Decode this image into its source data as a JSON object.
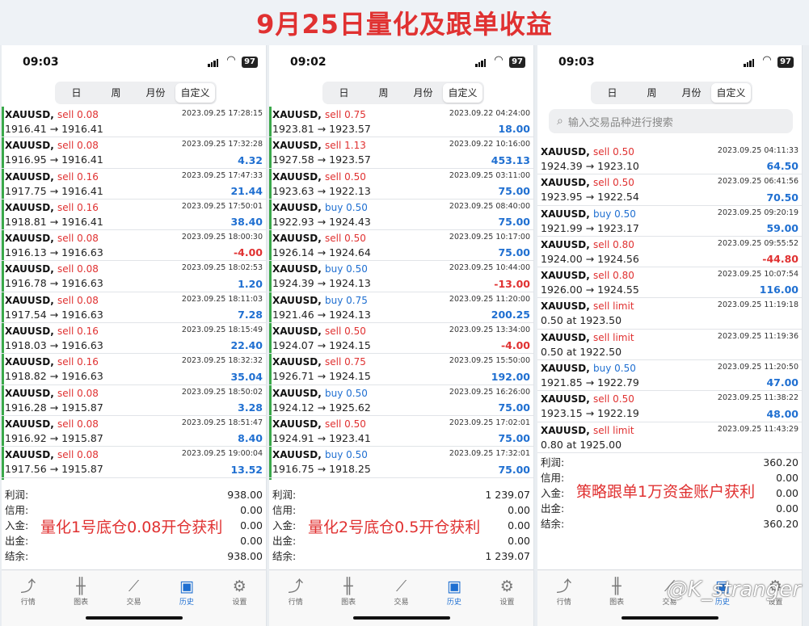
{
  "banner": {
    "title": "9月25日量化及跟单收益"
  },
  "segments": [
    "日",
    "周",
    "月份",
    "自定义"
  ],
  "tabs": [
    {
      "icon": "chart-line-icon",
      "glyph": "⤴",
      "label": "行情"
    },
    {
      "icon": "candlestick-icon",
      "glyph": "╫",
      "label": "图表"
    },
    {
      "icon": "trade-icon",
      "glyph": "⟋",
      "label": "交易"
    },
    {
      "icon": "history-icon",
      "glyph": "▣",
      "label": "历史"
    },
    {
      "icon": "gear-icon",
      "glyph": "⚙",
      "label": "设置"
    }
  ],
  "totals_labels": [
    "利润:",
    "信用:",
    "入金:",
    "出金:",
    "结余:"
  ],
  "phones": [
    {
      "time": "09:03",
      "battery": "97",
      "annotation": "量化1号底仓0.08开仓获利",
      "rows": [
        {
          "sym": "XAUUSD",
          "side": "sell",
          "lots": "0.08",
          "dt": "2023.09.25 17:28:15",
          "prices": "1916.41 → 1916.41",
          "pl": ""
        },
        {
          "sym": "XAUUSD",
          "side": "sell",
          "lots": "0.08",
          "dt": "2023.09.25 17:32:28",
          "prices": "1916.95 → 1916.41",
          "pl": "4.32"
        },
        {
          "sym": "XAUUSD",
          "side": "sell",
          "lots": "0.16",
          "dt": "2023.09.25 17:47:33",
          "prices": "1917.75 → 1916.41",
          "pl": "21.44"
        },
        {
          "sym": "XAUUSD",
          "side": "sell",
          "lots": "0.16",
          "dt": "2023.09.25 17:50:01",
          "prices": "1918.81 → 1916.41",
          "pl": "38.40"
        },
        {
          "sym": "XAUUSD",
          "side": "sell",
          "lots": "0.08",
          "dt": "2023.09.25 18:00:30",
          "prices": "1916.13 → 1916.63",
          "pl": "-4.00"
        },
        {
          "sym": "XAUUSD",
          "side": "sell",
          "lots": "0.08",
          "dt": "2023.09.25 18:02:53",
          "prices": "1916.78 → 1916.63",
          "pl": "1.20"
        },
        {
          "sym": "XAUUSD",
          "side": "sell",
          "lots": "0.08",
          "dt": "2023.09.25 18:11:03",
          "prices": "1917.54 → 1916.63",
          "pl": "7.28"
        },
        {
          "sym": "XAUUSD",
          "side": "sell",
          "lots": "0.16",
          "dt": "2023.09.25 18:15:49",
          "prices": "1918.03 → 1916.63",
          "pl": "22.40"
        },
        {
          "sym": "XAUUSD",
          "side": "sell",
          "lots": "0.16",
          "dt": "2023.09.25 18:32:32",
          "prices": "1918.82 → 1916.63",
          "pl": "35.04"
        },
        {
          "sym": "XAUUSD",
          "side": "sell",
          "lots": "0.08",
          "dt": "2023.09.25 18:50:02",
          "prices": "1916.28 → 1915.87",
          "pl": "3.28"
        },
        {
          "sym": "XAUUSD",
          "side": "sell",
          "lots": "0.08",
          "dt": "2023.09.25 18:51:47",
          "prices": "1916.92 → 1915.87",
          "pl": "8.40"
        },
        {
          "sym": "XAUUSD",
          "side": "sell",
          "lots": "0.08",
          "dt": "2023.09.25 19:00:04",
          "prices": "1917.56 → 1915.87",
          "pl": "13.52"
        }
      ],
      "totals": [
        "938.00",
        "0.00",
        "0.00",
        "0.00",
        "938.00"
      ]
    },
    {
      "time": "09:02",
      "battery": "97",
      "annotation": "量化2号底仓0.5开仓获利",
      "rows": [
        {
          "sym": "XAUUSD",
          "side": "sell",
          "lots": "0.75",
          "dt": "2023.09.22 04:24:00",
          "prices": "1923.81 → 1923.57",
          "pl": "18.00"
        },
        {
          "sym": "XAUUSD",
          "side": "sell",
          "lots": "1.13",
          "dt": "2023.09.22 10:16:00",
          "prices": "1927.58 → 1923.57",
          "pl": "453.13"
        },
        {
          "sym": "XAUUSD",
          "side": "sell",
          "lots": "0.50",
          "dt": "2023.09.25 03:11:00",
          "prices": "1923.63 → 1922.13",
          "pl": "75.00"
        },
        {
          "sym": "XAUUSD",
          "side": "buy",
          "lots": "0.50",
          "dt": "2023.09.25 08:40:00",
          "prices": "1922.93 → 1924.43",
          "pl": "75.00"
        },
        {
          "sym": "XAUUSD",
          "side": "sell",
          "lots": "0.50",
          "dt": "2023.09.25 10:17:00",
          "prices": "1926.14 → 1924.64",
          "pl": "75.00"
        },
        {
          "sym": "XAUUSD",
          "side": "buy",
          "lots": "0.50",
          "dt": "2023.09.25 10:44:00",
          "prices": "1924.39 → 1924.13",
          "pl": "-13.00"
        },
        {
          "sym": "XAUUSD",
          "side": "buy",
          "lots": "0.75",
          "dt": "2023.09.25 11:20:00",
          "prices": "1921.46 → 1924.13",
          "pl": "200.25"
        },
        {
          "sym": "XAUUSD",
          "side": "sell",
          "lots": "0.50",
          "dt": "2023.09.25 13:34:00",
          "prices": "1924.07 → 1924.15",
          "pl": "-4.00"
        },
        {
          "sym": "XAUUSD",
          "side": "sell",
          "lots": "0.75",
          "dt": "2023.09.25 15:50:00",
          "prices": "1926.71 → 1924.15",
          "pl": "192.00"
        },
        {
          "sym": "XAUUSD",
          "side": "buy",
          "lots": "0.50",
          "dt": "2023.09.25 16:26:00",
          "prices": "1924.12 → 1925.62",
          "pl": "75.00"
        },
        {
          "sym": "XAUUSD",
          "side": "sell",
          "lots": "0.50",
          "dt": "2023.09.25 17:02:01",
          "prices": "1924.91 → 1923.41",
          "pl": "75.00"
        },
        {
          "sym": "XAUUSD",
          "side": "buy",
          "lots": "0.50",
          "dt": "2023.09.25 17:32:01",
          "prices": "1916.75 → 1918.25",
          "pl": "75.00"
        }
      ],
      "totals": [
        "1 239.07",
        "0.00",
        "0.00",
        "0.00",
        "1 239.07"
      ]
    },
    {
      "time": "09:03",
      "battery": "97",
      "annotation": "策略跟单1万资金账户获利",
      "search_placeholder": "输入交易品种进行搜索",
      "rows": [
        {
          "sym": "XAUUSD",
          "side": "sell",
          "lots": "0.50",
          "dt": "2023.09.25 04:11:33",
          "prices": "1924.39 → 1923.10",
          "pl": "64.50"
        },
        {
          "sym": "XAUUSD",
          "side": "sell",
          "lots": "0.50",
          "dt": "2023.09.25 06:41:56",
          "prices": "1923.95 → 1922.54",
          "pl": "70.50"
        },
        {
          "sym": "XAUUSD",
          "side": "buy",
          "lots": "0.50",
          "dt": "2023.09.25 09:20:19",
          "prices": "1921.99 → 1923.17",
          "pl": "59.00"
        },
        {
          "sym": "XAUUSD",
          "side": "sell",
          "lots": "0.80",
          "dt": "2023.09.25 09:55:52",
          "prices": "1924.00 → 1924.56",
          "pl": "-44.80"
        },
        {
          "sym": "XAUUSD",
          "side": "sell",
          "lots": "0.80",
          "dt": "2023.09.25 10:07:54",
          "prices": "1926.00 → 1924.55",
          "pl": "116.00"
        },
        {
          "sym": "XAUUSD",
          "side": "sell limit",
          "lots": "",
          "dt": "2023.09.25 11:19:18",
          "prices": "0.50 at 1923.50",
          "pl": ""
        },
        {
          "sym": "XAUUSD",
          "side": "sell limit",
          "lots": "",
          "dt": "2023.09.25 11:19:36",
          "prices": "0.50 at 1922.50",
          "pl": ""
        },
        {
          "sym": "XAUUSD",
          "side": "buy",
          "lots": "0.50",
          "dt": "2023.09.25 11:20:50",
          "prices": "1921.85 → 1922.79",
          "pl": "47.00"
        },
        {
          "sym": "XAUUSD",
          "side": "sell",
          "lots": "0.50",
          "dt": "2023.09.25 11:38:22",
          "prices": "1923.15 → 1922.19",
          "pl": "48.00"
        },
        {
          "sym": "XAUUSD",
          "side": "sell limit",
          "lots": "",
          "dt": "2023.09.25 11:43:29",
          "prices": "0.80 at 1925.00",
          "pl": ""
        }
      ],
      "totals": [
        "360.20",
        "0.00",
        "0.00",
        "0.00",
        "360.20"
      ]
    }
  ],
  "watermark": "@K_stranger"
}
